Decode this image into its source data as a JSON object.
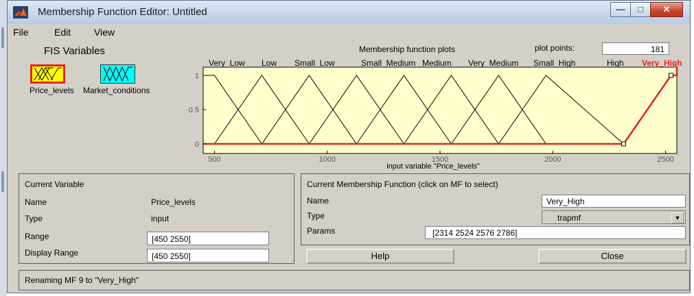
{
  "window": {
    "title": "Membership Function Editor: Untitled",
    "controls": {
      "minimize": "—",
      "maximize": "□",
      "close": "✕"
    }
  },
  "menu": [
    "File",
    "Edit",
    "View"
  ],
  "fis_variables": {
    "label": "FIS Variables",
    "inputs": [
      {
        "name": "Price_levels",
        "label": "Price_levels",
        "selected": true
      },
      {
        "name": "Market_conditions",
        "label": "Market_conditions",
        "selected": false
      }
    ]
  },
  "plot": {
    "title": "Membership function plots",
    "plot_points_label": "plot points:",
    "plot_points_value": "181",
    "x_label": "input variable \"Price_levels\"",
    "x_ticks": [
      "500",
      "1000",
      "1500",
      "2000",
      "2500"
    ],
    "y_ticks": [
      "0",
      "0.5",
      "1"
    ],
    "mf_labels": [
      "Very_Low",
      "Low",
      "Small_Low",
      "Small_Medium",
      "Medium",
      "Very_Medium",
      "Small_High",
      "High",
      "Very_High"
    ]
  },
  "chart_data": {
    "type": "line",
    "xlim": [
      450,
      2550
    ],
    "ylim": [
      0,
      1
    ],
    "xlabel": "input variable \"Price_levels\"",
    "series": [
      {
        "name": "Very_Low",
        "x": [
          450,
          450,
          500,
          710
        ],
        "y": [
          0,
          1,
          1,
          0
        ]
      },
      {
        "name": "Low",
        "x": [
          500,
          710,
          710,
          920
        ],
        "y": [
          0,
          1,
          1,
          0
        ]
      },
      {
        "name": "Small_Low",
        "x": [
          710,
          920,
          920,
          1130
        ],
        "y": [
          0,
          1,
          1,
          0
        ]
      },
      {
        "name": "Small_Medium",
        "x": [
          920,
          1130,
          1130,
          1340
        ],
        "y": [
          0,
          1,
          1,
          0
        ]
      },
      {
        "name": "Medium",
        "x": [
          1130,
          1340,
          1340,
          1550
        ],
        "y": [
          0,
          1,
          1,
          0
        ]
      },
      {
        "name": "Very_Medium",
        "x": [
          1340,
          1550,
          1550,
          1760
        ],
        "y": [
          0,
          1,
          1,
          0
        ]
      },
      {
        "name": "Small_High",
        "x": [
          1550,
          1760,
          1760,
          1970
        ],
        "y": [
          0,
          1,
          1,
          0
        ]
      },
      {
        "name": "High",
        "x": [
          1760,
          1970,
          1970,
          2314
        ],
        "y": [
          0,
          1,
          1,
          0
        ]
      },
      {
        "name": "Very_High",
        "x": [
          2314,
          2524,
          2576,
          2786
        ],
        "y": [
          0,
          1,
          1,
          0
        ],
        "selected": true
      }
    ]
  },
  "current_variable": {
    "header": "Current Variable",
    "name_label": "Name",
    "name_value": "Price_levels",
    "type_label": "Type",
    "type_value": "input",
    "range_label": "Range",
    "range_value": "[450 2550]",
    "display_range_label": "Display Range",
    "display_range_value": "[450 2550]"
  },
  "current_mf": {
    "header": "Current Membership Function (click on MF to select)",
    "name_label": "Name",
    "name_value": "Very_High",
    "type_label": "Type",
    "type_value": "trapmf",
    "params_label": "Params",
    "params_value": "[2314 2524 2576 2786]"
  },
  "buttons": {
    "help": "Help",
    "close": "Close"
  },
  "status": "Renaming MF 9 to \"Very_High\"",
  "colors": {
    "plot_bg": "#ffffcc",
    "selected": "#e8231a",
    "accent": "#00ffff"
  }
}
